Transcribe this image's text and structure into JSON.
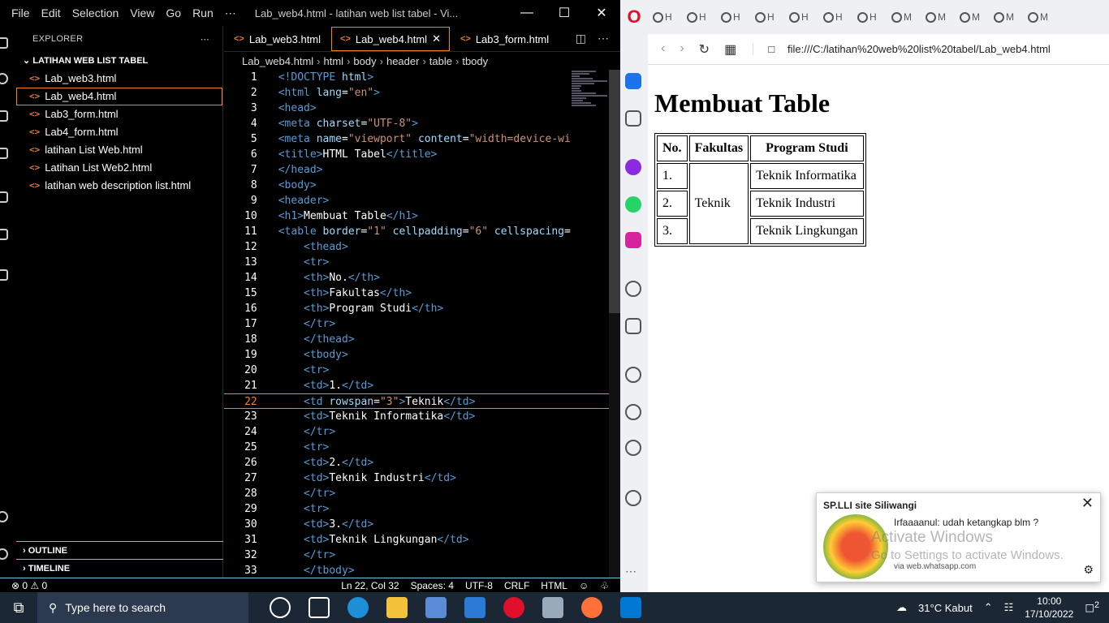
{
  "vscode": {
    "menu": [
      "File",
      "Edit",
      "Selection",
      "View",
      "Go",
      "Run",
      "⋯"
    ],
    "window_title": "Lab_web4.html - latihan web list tabel - Vi...",
    "explorer_label": "EXPLORER",
    "folder": "LATIHAN WEB LIST TABEL",
    "files": [
      "Lab_web3.html",
      "Lab_web4.html",
      "Lab3_form.html",
      "Lab4_form.html",
      "latihan List Web.html",
      "Latihan List Web2.html",
      "latihan web description list.html"
    ],
    "outline_label": "OUTLINE",
    "timeline_label": "TIMELINE",
    "tabs": [
      "Lab_web3.html",
      "Lab_web4.html",
      "Lab3_form.html"
    ],
    "breadcrumb": [
      "Lab_web4.html",
      "html",
      "body",
      "header",
      "table",
      "tbody"
    ],
    "status": {
      "problems": "⊗ 0 ⚠ 0",
      "position": "Ln 22, Col 32",
      "spaces": "Spaces: 4",
      "encoding": "UTF-8",
      "eol": "CRLF",
      "language": "HTML"
    }
  },
  "code_lines": [
    {
      "n": "1",
      "html": "<span class='t'>&lt;!DOCTYPE</span> <span class='a'>html</span><span class='t'>&gt;</span>"
    },
    {
      "n": "2",
      "html": "<span class='t'>&lt;html</span> <span class='a'>lang</span>=<span class='s'>\"en\"</span><span class='t'>&gt;</span>"
    },
    {
      "n": "3",
      "html": "<span class='t'>&lt;head&gt;</span>"
    },
    {
      "n": "4",
      "html": "<span class='t'>&lt;meta</span> <span class='a'>charset</span>=<span class='s'>\"UTF-8\"</span><span class='t'>&gt;</span>"
    },
    {
      "n": "5",
      "html": "<span class='t'>&lt;meta</span> <span class='a'>name</span>=<span class='s'>\"viewport\"</span> <span class='a'>content</span>=<span class='s'>\"width=device-wi</span>"
    },
    {
      "n": "6",
      "html": "<span class='t'>&lt;title&gt;</span>HTML Tabel<span class='t'>&lt;/title&gt;</span>"
    },
    {
      "n": "7",
      "html": "<span class='t'>&lt;/head&gt;</span>"
    },
    {
      "n": "8",
      "html": "<span class='t'>&lt;body&gt;</span>"
    },
    {
      "n": "9",
      "html": "<span class='t'>&lt;header&gt;</span>"
    },
    {
      "n": "10",
      "html": "<span class='t'>&lt;h1&gt;</span>Membuat Table<span class='t'>&lt;/h1&gt;</span>"
    },
    {
      "n": "11",
      "html": "<span class='t'>&lt;table</span> <span class='a'>border</span>=<span class='s'>\"1\"</span> <span class='a'>cellpadding</span>=<span class='s'>\"6\"</span> <span class='a'>cellspacing</span>="
    },
    {
      "n": "12",
      "html": "    <span class='t'>&lt;thead&gt;</span>"
    },
    {
      "n": "13",
      "html": "    <span class='t'>&lt;tr&gt;</span>"
    },
    {
      "n": "14",
      "html": "    <span class='t'>&lt;th&gt;</span>No.<span class='t'>&lt;/th&gt;</span>"
    },
    {
      "n": "15",
      "html": "    <span class='t'>&lt;th&gt;</span>Fakultas<span class='t'>&lt;/th&gt;</span>"
    },
    {
      "n": "16",
      "html": "    <span class='t'>&lt;th&gt;</span>Program Studi<span class='t'>&lt;/th&gt;</span>"
    },
    {
      "n": "17",
      "html": "    <span class='t'>&lt;/tr&gt;</span>"
    },
    {
      "n": "18",
      "html": "    <span class='t'>&lt;/thead&gt;</span>"
    },
    {
      "n": "19",
      "html": "    <span class='t'>&lt;tbody&gt;</span>"
    },
    {
      "n": "20",
      "html": "    <span class='t'>&lt;tr&gt;</span>"
    },
    {
      "n": "21",
      "html": "    <span class='t'>&lt;td&gt;</span>1.<span class='t'>&lt;/td&gt;</span>"
    },
    {
      "n": "22",
      "html": "    <span class='t'>&lt;td</span> <span class='a'>rowspan</span>=<span class='s'>\"3\"</span><span class='t'>&gt;</span>Teknik<span class='t'>&lt;/td&gt;</span>",
      "cur": true
    },
    {
      "n": "23",
      "html": "    <span class='t'>&lt;td&gt;</span>Teknik Informatika<span class='t'>&lt;/td&gt;</span>"
    },
    {
      "n": "24",
      "html": "    <span class='t'>&lt;/tr&gt;</span>"
    },
    {
      "n": "25",
      "html": "    <span class='t'>&lt;tr&gt;</span>"
    },
    {
      "n": "26",
      "html": "    <span class='t'>&lt;td&gt;</span>2.<span class='t'>&lt;/td&gt;</span>"
    },
    {
      "n": "27",
      "html": "    <span class='t'>&lt;td&gt;</span>Teknik Industri<span class='t'>&lt;/td&gt;</span>"
    },
    {
      "n": "28",
      "html": "    <span class='t'>&lt;/tr&gt;</span>"
    },
    {
      "n": "29",
      "html": "    <span class='t'>&lt;tr&gt;</span>"
    },
    {
      "n": "30",
      "html": "    <span class='t'>&lt;td&gt;</span>3.<span class='t'>&lt;/td&gt;</span>"
    },
    {
      "n": "31",
      "html": "    <span class='t'>&lt;td&gt;</span>Teknik Lingkungan<span class='t'>&lt;/td&gt;</span>"
    },
    {
      "n": "32",
      "html": "    <span class='t'>&lt;/tr&gt;</span>"
    },
    {
      "n": "33",
      "html": "<span class='selbg'>    <span class='t'>&lt;/tbody&gt;</span>              </span>"
    }
  ],
  "browser": {
    "url": "file:///C:/latihan%20web%20list%20tabel/Lab_web4.html",
    "tab_label": "H",
    "tab_label_alt": "M",
    "heading": "Membuat Table",
    "table": {
      "headers": [
        "No.",
        "Fakultas",
        "Program Studi"
      ],
      "faculty": "Teknik",
      "rows": [
        [
          "1.",
          "Teknik Informatika"
        ],
        [
          "2.",
          "Teknik Industri"
        ],
        [
          "3.",
          "Teknik Lingkungan"
        ]
      ]
    }
  },
  "notification": {
    "title": "SP.LLI site Siliwangi",
    "message": "Irfaaaanul: udah ketangkap blm ?",
    "via": "via web.whatsapp.com"
  },
  "watermark": {
    "line1": "Activate Windows",
    "line2": "Go to Settings to activate Windows."
  },
  "taskbar": {
    "search_placeholder": "Type here to search",
    "weather": "31°C  Kabut",
    "time": "10:00",
    "date": "17/10/2022",
    "notif_count": "2"
  }
}
